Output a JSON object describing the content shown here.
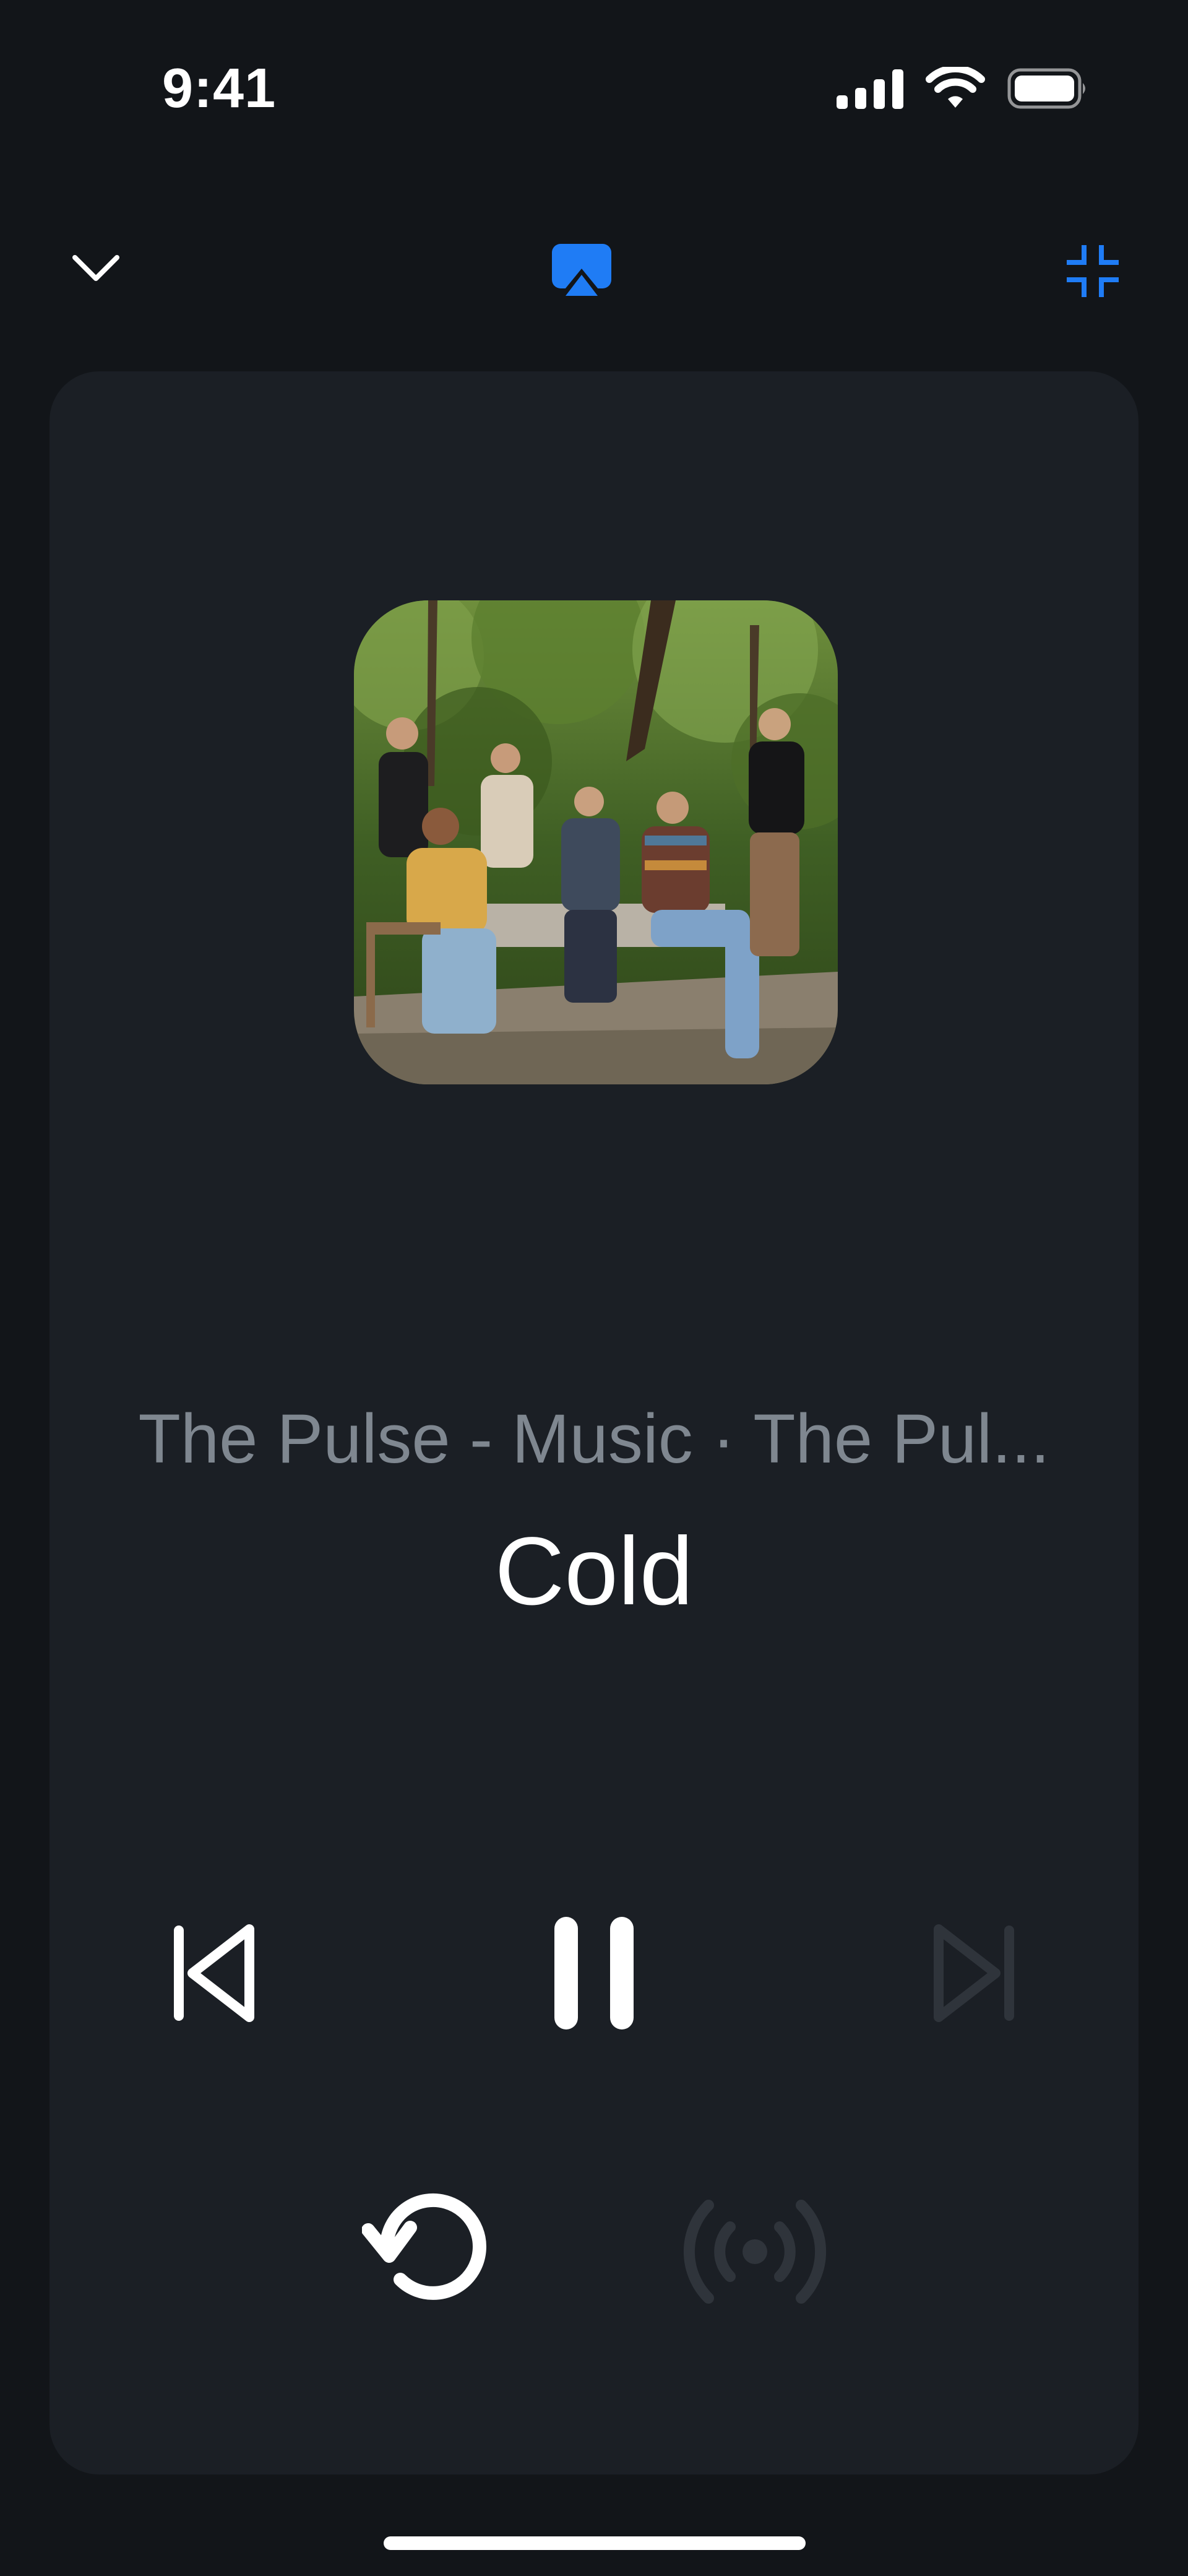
{
  "status_bar": {
    "time": "9:41",
    "icons": [
      "signal-icon",
      "wifi-icon",
      "battery-icon"
    ]
  },
  "top_bar": {
    "icons": [
      "chevron-down-icon",
      "airplay-icon",
      "minimize-icon"
    ],
    "accent_color": "#1f7cf5"
  },
  "now_playing": {
    "artwork_label": "Album artwork",
    "subtitle": "The Pulse - Music · The Pul...",
    "title": "Cold"
  },
  "controls": {
    "previous": {
      "icon": "skip-previous-icon",
      "enabled": true
    },
    "play_pause": {
      "icon": "pause-icon",
      "state": "playing"
    },
    "next": {
      "icon": "skip-next-icon",
      "enabled": false
    },
    "restart": {
      "icon": "restart-icon",
      "enabled": true
    },
    "broadcast": {
      "icon": "broadcast-icon",
      "enabled": false
    }
  },
  "colors": {
    "background": "#121519",
    "card": "#1b1f25",
    "subtitle": "#7f8790",
    "disabled": "#2f343b"
  }
}
